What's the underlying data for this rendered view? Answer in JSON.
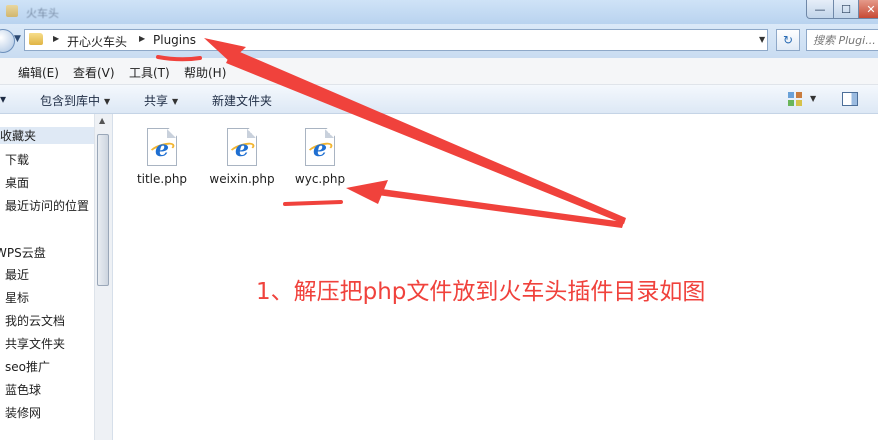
{
  "window": {
    "title": "火车头",
    "controls": {
      "minimize": "—",
      "maximize": "☐",
      "close": "✕"
    }
  },
  "address_bar": {
    "breadcrumbs": [
      "开心火车头",
      "Plugins"
    ],
    "search_placeholder": "搜索 Plugi..."
  },
  "menu": {
    "items": [
      "编辑(E)",
      "查看(V)",
      "工具(T)",
      "帮助(H)"
    ]
  },
  "toolbar": {
    "include_in_library": "包含到库中",
    "share": "共享",
    "new_folder": "新建文件夹"
  },
  "sidebar": {
    "favorites_header": "收藏夹",
    "favorites": [
      "下载",
      "桌面",
      "最近访问的位置"
    ],
    "wps_header": "WPS云盘",
    "wps_items": [
      "最近",
      "星标",
      "我的云文档",
      "共享文件夹",
      "seo推广",
      "蓝色球",
      "装修网"
    ]
  },
  "files": [
    {
      "name": "title.php",
      "icon": "ie-php-file-icon"
    },
    {
      "name": "weixin.php",
      "icon": "ie-php-file-icon"
    },
    {
      "name": "wyc.php",
      "icon": "ie-php-file-icon"
    }
  ],
  "annotation": {
    "text": "1、解压把php文件放到火车头插件目录如图",
    "color": "#f0423c"
  }
}
